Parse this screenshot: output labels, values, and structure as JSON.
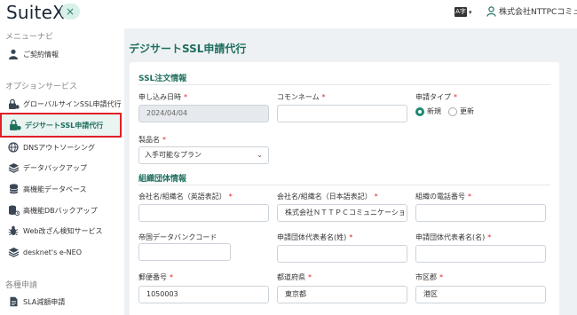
{
  "app": {
    "logo": "SuiteX",
    "close_symbol": "×",
    "lang_label": "A字",
    "lang_caret": "▾",
    "user_name": "株式会社NTTPCコミュニ"
  },
  "sidebar": {
    "menu_nav_title": "メニューナビ",
    "options_title": "オプションサービス",
    "applications_title": "各種申請",
    "items": [
      {
        "label": "ご契約情報",
        "icon": "person-icon"
      },
      {
        "label": "グローバルサインSSL申請代行",
        "icon": "lock-user-icon"
      },
      {
        "label": "デジサートSSL申請代行",
        "icon": "lock-user-icon"
      },
      {
        "label": "DNSアウトソーシング",
        "icon": "globe-icon"
      },
      {
        "label": "データバックアップ",
        "icon": "layers-icon"
      },
      {
        "label": "高機能データベース",
        "icon": "database-icon"
      },
      {
        "label": "高機能DBバックアップ",
        "icon": "database-backup-icon"
      },
      {
        "label": "Web改ざん検知サービス",
        "icon": "bug-icon"
      },
      {
        "label": "desknet's e-NEO",
        "icon": "layers-icon"
      },
      {
        "label": "SLA減額申請",
        "icon": "document-icon"
      }
    ]
  },
  "main": {
    "page_title": "デジサートSSL申請代行",
    "required_mark": "*",
    "ssl_section": {
      "title": "SSL注文情報",
      "apply_date_label": "申し込み日時",
      "apply_date_value": "2024/04/04",
      "common_name_label": "コモンネーム",
      "common_name_value": "",
      "apply_type_label": "申請タイプ",
      "apply_type_options": [
        "新規",
        "更新"
      ],
      "apply_type_selected": "新規",
      "product_label": "製品名",
      "product_value": "入手可能なプラン",
      "select_caret": "⌄"
    },
    "org_section": {
      "title": "組織団体情報",
      "org_name_en_label": "会社名/組織名（英語表記）",
      "org_name_en_value": "",
      "org_name_jp_label": "会社名/組織名（日本語表記）",
      "org_name_jp_value": "株式会社ＮＴＴＰＣコミュニケーションズ",
      "org_phone_label": "組織の電話番号",
      "org_phone_value": "",
      "duns_label": "帝国データバンクコード",
      "duns_value": "",
      "rep_last_label": "申請団体代表者名(姓)",
      "rep_last_value": "",
      "rep_first_label": "申請団体代表者名(名)",
      "rep_first_value": "",
      "postal_label": "郵便番号",
      "postal_value": "1050003",
      "prefecture_label": "都道府県",
      "prefecture_value": "東京都",
      "city_label": "市区郡",
      "city_value": "港区"
    }
  },
  "colors": {
    "accent": "#1f6f5e",
    "highlight_border": "#e01f26",
    "background": "#eef1f4"
  }
}
